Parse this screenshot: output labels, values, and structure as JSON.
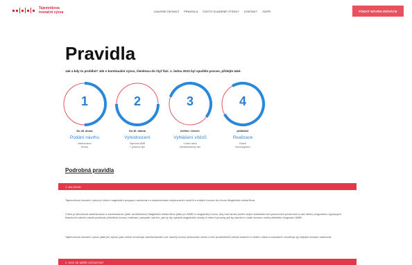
{
  "header": {
    "logo": {
      "line1": "Tajemníkova",
      "line2": "inovační výzva"
    },
    "nav": [
      "GALERIE INOVACÍ",
      "PRAVIDLA",
      "ČASTO KLADENÉ OTÁZKY",
      "KONTAKT",
      "GDPR"
    ],
    "cta_label": "PODAT NÁVRH INOVACE"
  },
  "page": {
    "title": "Pravidla",
    "subtitle": "Jak a kdy to probíhá? Jde o kontinuální výzvu, členěnou do čtyř fází. 1. ledna 2023 byl spuštěn proces, přidejte také."
  },
  "steps": [
    {
      "number": "1",
      "date": "Do 28. února",
      "title": "Podání návrhu",
      "desc": [
        "elektronickou",
        "formou"
      ],
      "progress": 0.5,
      "ring_color": "#e05560"
    },
    {
      "number": "2",
      "date": "Do 30. dubna",
      "title": "Vyhodnocení",
      "desc": [
        "Tajemník MMB",
        "+ pracovní tým"
      ],
      "progress": 0.5,
      "ring_color": "#e05560"
    },
    {
      "number": "3",
      "date": "květen / červen",
      "title": "Vyhlášení vítězů",
      "desc": [
        "V rámci akce",
        "Zaměstnanecký den"
      ],
      "progress": 0.55,
      "ring_color": "#2b88d8"
    },
    {
      "number": "4",
      "date": "průběžně",
      "title": "Realizace",
      "desc": [
        "Hodně",
        "hornonogramu"
      ],
      "progress": 0.75,
      "ring_color": "#2b88d8"
    }
  ],
  "details": {
    "heading": "Podrobná pravidla",
    "section1_label": "1. NA ÚVOD",
    "paragraphs": [
      "Tajemníkova inovační výzva je interní magistrátní program navrhování a implementace zlepšovacích návrhů a malých inovací do chodu Magistrátu města Brna.",
      "Cílem je stimulovat zaměstnance a zaměstnance (dále zaměstnanci) Magistrátu města Brna (dále jen MMB či magistrát) k tomu, aby nad rámec plnění svých každodenních pracovních povinností a nad rámec programem vypsaných finančních odměn začali pocitovat příležitost inovací motivaci; zamyslet nad tím, jak by šly vylepšit magistrátní služby či interní procesy jak by navrženi i malé inovace mohly efektivitu fungování MMB.",
      "Tajemníkova inovační výzva (dále jen výzva) pak reálně umožňuje zaměstnancům své návrhy inovací jednoduše online a bez prostředníků předat směrem k vedení úřadu a současně umožňuje tyj nejlepší inovace realizovat."
    ],
    "section2_label": "2. KDO SE MŮŽE ZÚČASTNIT"
  }
}
